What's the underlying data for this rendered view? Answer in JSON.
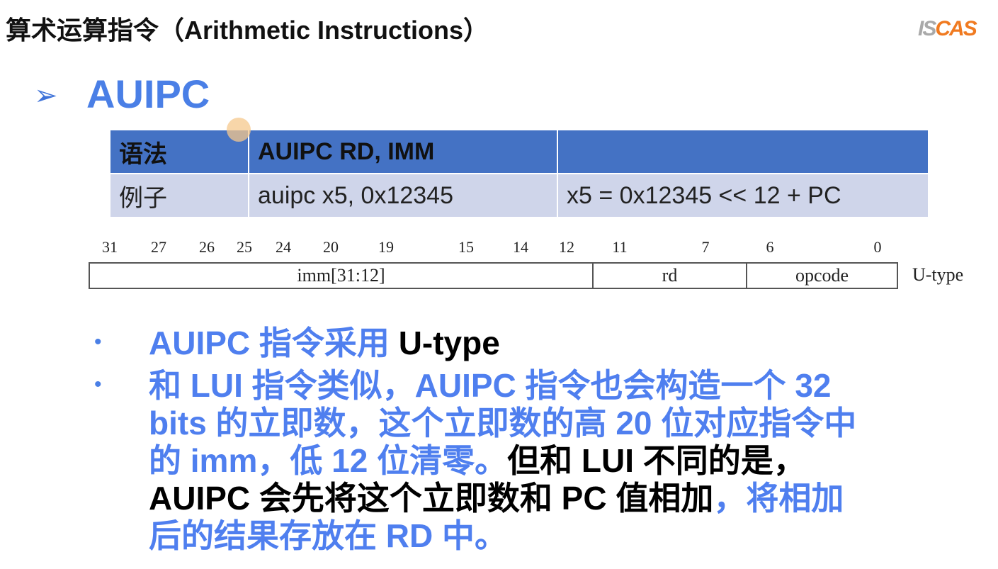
{
  "title": "算术运算指令（Arithmetic Instructions）",
  "logo": {
    "text": "ISCAS",
    "colors": [
      "#a9a9a9",
      "#f07a20"
    ]
  },
  "heading": "AUIPC",
  "table": {
    "header": [
      "语法",
      "AUIPC RD, IMM",
      ""
    ],
    "row": [
      "例子",
      "auipc x5, 0x12345",
      "x5 = 0x12345 << 12 + PC"
    ],
    "colors": {
      "header": "#4472c4",
      "row": "#cfd5ea"
    }
  },
  "encoding": {
    "bits": [
      "31",
      "27",
      "26",
      "25",
      "24",
      "20",
      "19",
      "15",
      "14",
      "12",
      "11",
      "7",
      "6",
      "0"
    ],
    "fields": [
      "imm[31:12]",
      "rd",
      "opcode"
    ],
    "type": "U-type"
  },
  "bullets": [
    {
      "lines": [
        [
          {
            "t": "AUIPC 指令采用 ",
            "c": "blue"
          },
          {
            "t": "U-type",
            "c": "black"
          }
        ]
      ]
    },
    {
      "lines": [
        [
          {
            "t": "和 LUI 指令类似，AUIPC 指令也会构造一个 32",
            "c": "blue"
          }
        ],
        [
          {
            "t": "bits 的立即数，这个立即数的高 20 位对应指令中",
            "c": "blue"
          }
        ],
        [
          {
            "t": "的 imm，低 12 位清零。",
            "c": "blue"
          },
          {
            "t": "但和 LUI 不同的是，",
            "c": "black"
          }
        ],
        [
          {
            "t": "AUIPC 会先将这个立即数和 PC 值相加",
            "c": "black"
          },
          {
            "t": "，将相加",
            "c": "blue"
          }
        ],
        [
          {
            "t": "后的结果存放在 RD 中。",
            "c": "blue"
          }
        ]
      ]
    }
  ],
  "colors": {
    "accent": "#4f7fef",
    "text": "#000000"
  }
}
